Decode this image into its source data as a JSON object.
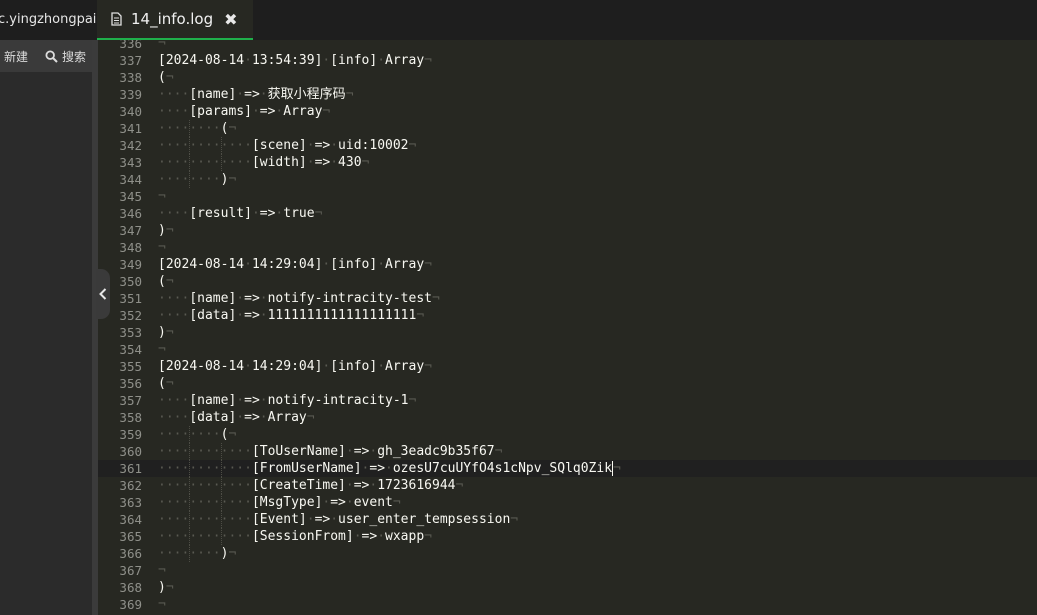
{
  "sidebar": {
    "title": "c.yingzhongpai",
    "toolbar": {
      "new_label": "新建",
      "search_label": "搜索"
    }
  },
  "tabs": [
    {
      "label": "14_info.log",
      "active": true,
      "close_glyph": "✖"
    }
  ],
  "editor": {
    "current_line": 361,
    "lines": [
      {
        "n": 336,
        "indent": 0,
        "text": ""
      },
      {
        "n": 337,
        "indent": 0,
        "text": "[2024-08-14 13:54:39] [info] Array"
      },
      {
        "n": 338,
        "indent": 0,
        "text": "("
      },
      {
        "n": 339,
        "indent": 4,
        "text": "[name] => 获取小程序码"
      },
      {
        "n": 340,
        "indent": 4,
        "text": "[params] => Array"
      },
      {
        "n": 341,
        "indent": 8,
        "text": "("
      },
      {
        "n": 342,
        "indent": 12,
        "text": "[scene] => uid:10002"
      },
      {
        "n": 343,
        "indent": 12,
        "text": "[width] => 430"
      },
      {
        "n": 344,
        "indent": 8,
        "text": ")"
      },
      {
        "n": 345,
        "indent": 0,
        "text": ""
      },
      {
        "n": 346,
        "indent": 4,
        "text": "[result] => true"
      },
      {
        "n": 347,
        "indent": 0,
        "text": ")"
      },
      {
        "n": 348,
        "indent": 0,
        "text": ""
      },
      {
        "n": 349,
        "indent": 0,
        "text": "[2024-08-14 14:29:04] [info] Array"
      },
      {
        "n": 350,
        "indent": 0,
        "text": "("
      },
      {
        "n": 351,
        "indent": 4,
        "text": "[name] => notify-intracity-test"
      },
      {
        "n": 352,
        "indent": 4,
        "text": "[data] => 1111111111111111111"
      },
      {
        "n": 353,
        "indent": 0,
        "text": ")"
      },
      {
        "n": 354,
        "indent": 0,
        "text": ""
      },
      {
        "n": 355,
        "indent": 0,
        "text": "[2024-08-14 14:29:04] [info] Array"
      },
      {
        "n": 356,
        "indent": 0,
        "text": "("
      },
      {
        "n": 357,
        "indent": 4,
        "text": "[name] => notify-intracity-1"
      },
      {
        "n": 358,
        "indent": 4,
        "text": "[data] => Array"
      },
      {
        "n": 359,
        "indent": 8,
        "text": "("
      },
      {
        "n": 360,
        "indent": 12,
        "text": "[ToUserName] => gh_3eadc9b35f67"
      },
      {
        "n": 361,
        "indent": 12,
        "text": "[FromUserName] => ozesU7cuUYfO4s1cNpv_SQlq0Zik"
      },
      {
        "n": 362,
        "indent": 12,
        "text": "[CreateTime] => 1723616944"
      },
      {
        "n": 363,
        "indent": 12,
        "text": "[MsgType] => event"
      },
      {
        "n": 364,
        "indent": 12,
        "text": "[Event] => user_enter_tempsession"
      },
      {
        "n": 365,
        "indent": 12,
        "text": "[SessionFrom] => wxapp"
      },
      {
        "n": 366,
        "indent": 8,
        "text": ")"
      },
      {
        "n": 367,
        "indent": 0,
        "text": ""
      },
      {
        "n": 368,
        "indent": 0,
        "text": ")"
      },
      {
        "n": 369,
        "indent": 0,
        "text": ""
      }
    ]
  },
  "colors": {
    "editor_bg": "#272822",
    "text": "#f8f8f2",
    "line_number": "#8f908a",
    "invisibles": "#5a5a52",
    "tab_accent": "#1fb04b"
  }
}
